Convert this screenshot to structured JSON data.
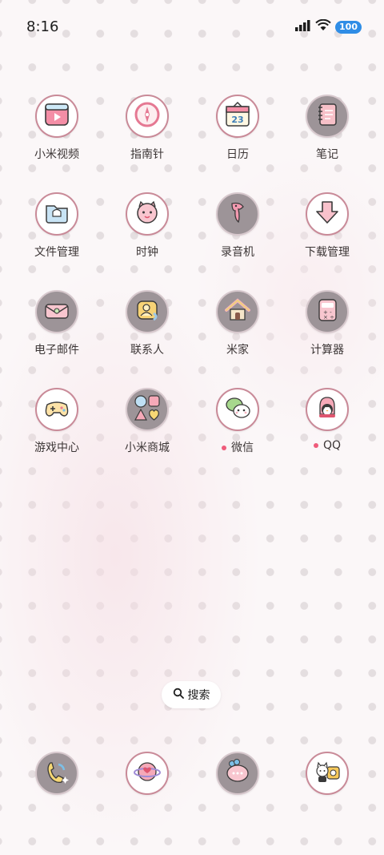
{
  "status_bar": {
    "time": "8:16",
    "battery": "100"
  },
  "apps": [
    {
      "label": "小米视频",
      "icon": "video-icon",
      "badge": false
    },
    {
      "label": "指南针",
      "icon": "compass-icon",
      "badge": false
    },
    {
      "label": "日历",
      "icon": "calendar-icon",
      "badge": false,
      "day": "23"
    },
    {
      "label": "笔记",
      "icon": "notes-icon",
      "badge": false
    },
    {
      "label": "文件管理",
      "icon": "folder-icon",
      "badge": false
    },
    {
      "label": "时钟",
      "icon": "clock-icon",
      "badge": false
    },
    {
      "label": "录音机",
      "icon": "recorder-icon",
      "badge": false
    },
    {
      "label": "下载管理",
      "icon": "download-icon",
      "badge": false
    },
    {
      "label": "电子邮件",
      "icon": "mail-icon",
      "badge": false
    },
    {
      "label": "联系人",
      "icon": "contacts-icon",
      "badge": false
    },
    {
      "label": "米家",
      "icon": "home-icon",
      "badge": false
    },
    {
      "label": "计算器",
      "icon": "calculator-icon",
      "badge": false
    },
    {
      "label": "游戏中心",
      "icon": "gamepad-icon",
      "badge": false
    },
    {
      "label": "小米商城",
      "icon": "store-icon",
      "badge": false
    },
    {
      "label": "微信",
      "icon": "wechat-icon",
      "badge": true
    },
    {
      "label": "QQ",
      "icon": "qq-icon",
      "badge": true
    }
  ],
  "search": {
    "label": "搜索"
  },
  "dock": [
    {
      "icon": "phone-icon"
    },
    {
      "icon": "browser-icon"
    },
    {
      "icon": "messages-icon"
    },
    {
      "icon": "camera-icon"
    }
  ],
  "colors": {
    "accent": "#ef5b7a",
    "icon_ring": "#c98a98",
    "battery": "#2f8de6"
  }
}
